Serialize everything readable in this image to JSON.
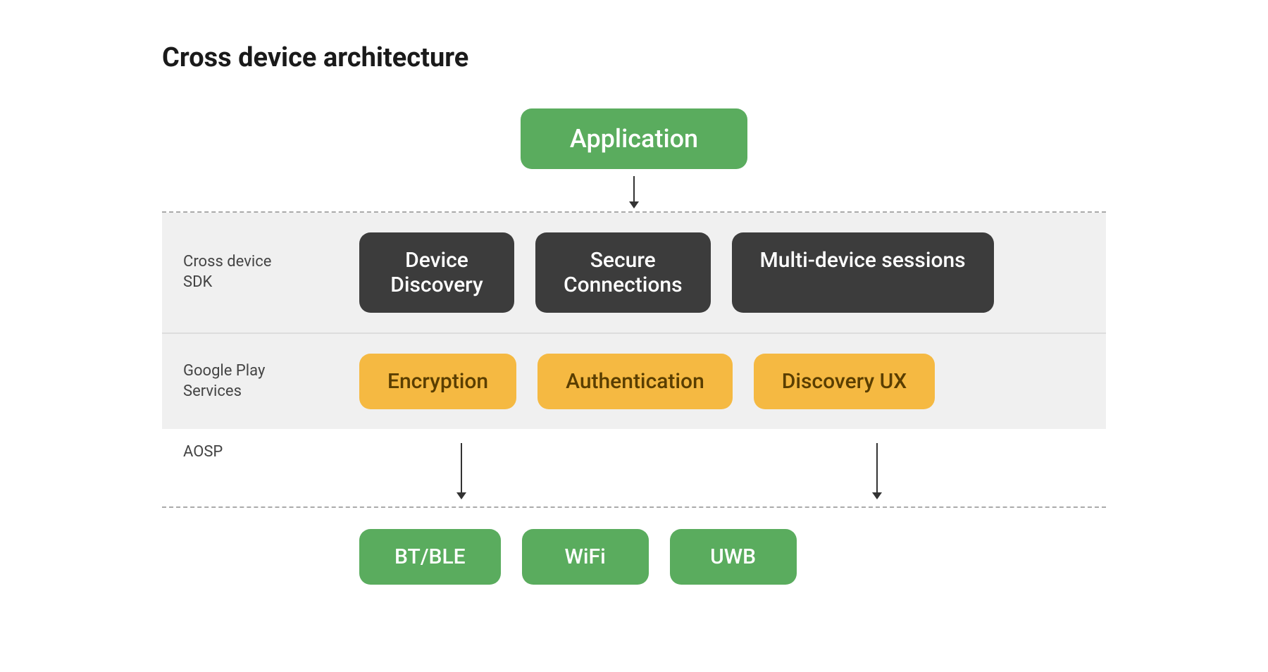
{
  "title": "Cross device architecture",
  "application_box": "Application",
  "bands": {
    "sdk": {
      "label": "Cross device\nSDK",
      "items": [
        "Device\nDiscovery",
        "Secure\nConnections",
        "Multi-device sessions"
      ]
    },
    "play_services": {
      "label": "Google Play\nServices",
      "items": [
        "Encryption",
        "Authentication",
        "Discovery UX"
      ]
    }
  },
  "aosp_label": "AOSP",
  "bottom_boxes": [
    "BT/BLE",
    "WiFi",
    "UWB"
  ]
}
